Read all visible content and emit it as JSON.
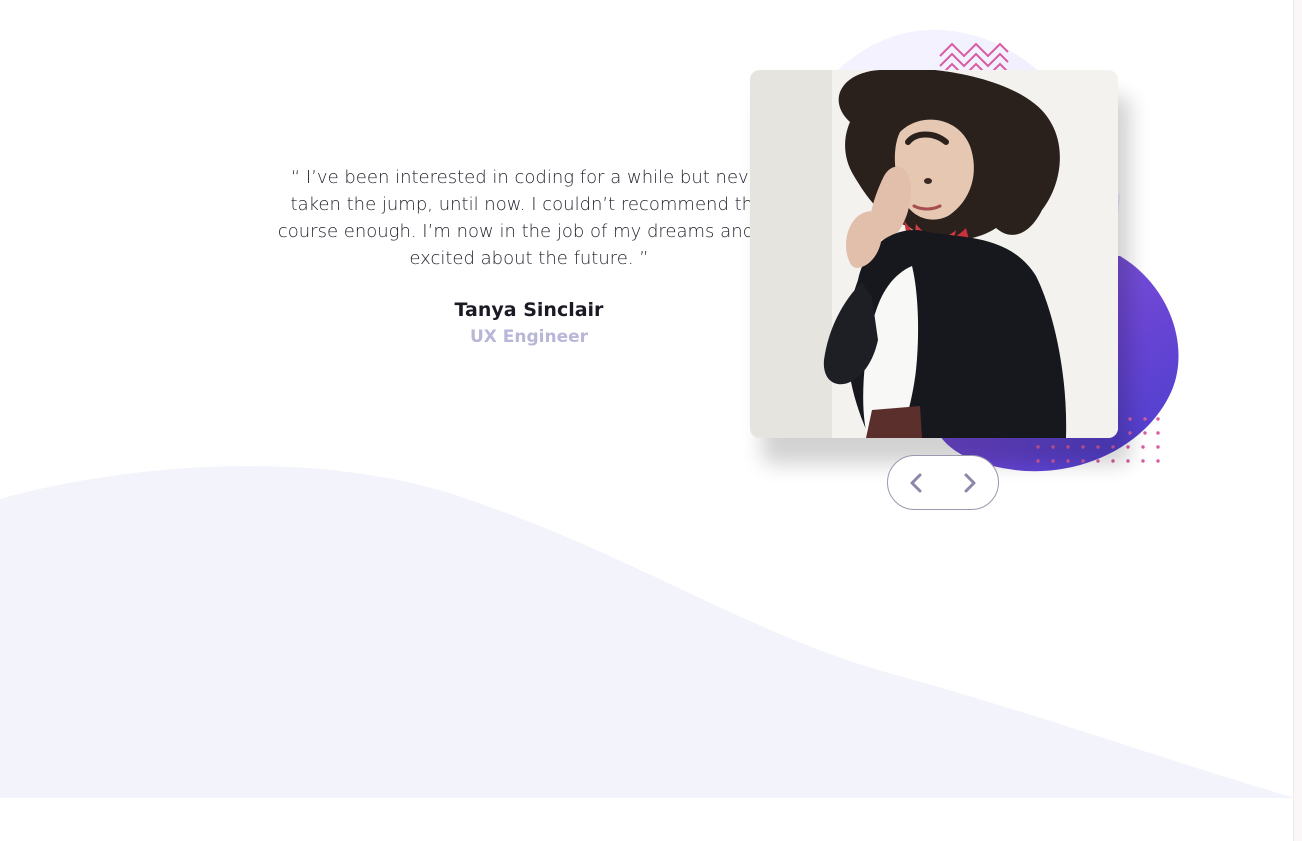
{
  "testimonial": {
    "quote": "“ I’ve been interested in coding for a while but never taken the jump, until now. I couldn’t recommend this course enough. I’m now in the job of my dreams and so excited about the future. ”",
    "name": "Tanya Sinclair",
    "role": "UX Engineer"
  },
  "icons": {
    "prev": "chevron-left-icon",
    "next": "chevron-right-icon"
  },
  "colors": {
    "background_curve": "#f3f3fb",
    "blob_top": "#7f57d7",
    "blob_bottom": "#4f3fce",
    "accent_pink": "#d85ca3",
    "role_text": "#b8b7d8",
    "pager_border": "#9a98ac",
    "pager_icon": "#8a88aa"
  }
}
